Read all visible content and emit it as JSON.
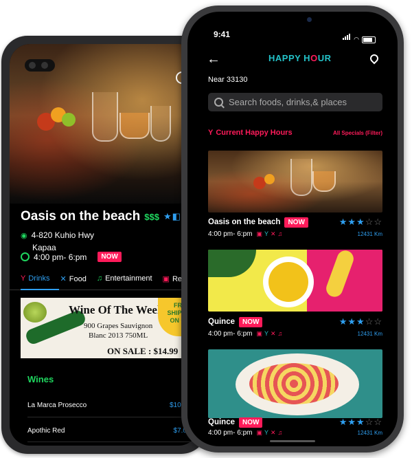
{
  "android": {
    "venue": {
      "name": "Oasis on the beach",
      "price_level": "$$$",
      "rating": 2.5,
      "address_line1": "4-820 Kuhio Hwy",
      "address_line2": "Kapaa",
      "hours": "4:00 pm- 6:pm",
      "badge": "NOW"
    },
    "tabs": [
      {
        "label": "Drinks",
        "icon": "cocktail-icon",
        "active": true
      },
      {
        "label": "Food",
        "icon": "utensils-icon",
        "active": false
      },
      {
        "label": "Entertainment",
        "icon": "music-icon",
        "active": false
      },
      {
        "label": "Re",
        "icon": "gift-icon",
        "active": false
      }
    ],
    "ad": {
      "title": "Wine Of The Week",
      "subtitle_line1": "900 Grapes Sauvignon",
      "subtitle_line2": "Blanc 2013 750ML",
      "sale": "ON SALE : $14.99",
      "badge_line1": "FREE",
      "badge_line2": "SHIPPING",
      "badge_line3": "ON CAS"
    },
    "menu": {
      "section": "Wines",
      "items": [
        {
          "name": "La Marca Prosecco",
          "price": "$10.9"
        },
        {
          "name": "Apothic Red",
          "price": "$7.0"
        }
      ]
    }
  },
  "iphone": {
    "status_time": "9:41",
    "logo_text": "HAPPY HOUR",
    "logo_pre": "HAPPY H",
    "logo_o": "O",
    "logo_post": "UR",
    "near": "Near 33130",
    "search_placeholder": "Search foods, drinks,& places",
    "section_title": "Current Happy Hours",
    "filter_label": "All Specials (Filter)",
    "cards": [
      {
        "name": "Oasis on the beach",
        "badge": "NOW",
        "time": "4:00 pm- 6:pm",
        "distance": "12431 Km",
        "rating": 3
      },
      {
        "name": "Quince",
        "badge": "NOW",
        "time": "4:00 pm- 6:pm",
        "distance": "12431 Km",
        "rating": 3
      },
      {
        "name": "Quince",
        "badge": "NOW",
        "time": "4:00 pm- 6:pm",
        "distance": "12431 Km",
        "rating": 3
      }
    ]
  },
  "colors": {
    "accent_pink": "#ff1b5a",
    "accent_blue": "#2f9ff0",
    "accent_green": "#1fd65f",
    "accent_teal": "#23c2c8"
  }
}
